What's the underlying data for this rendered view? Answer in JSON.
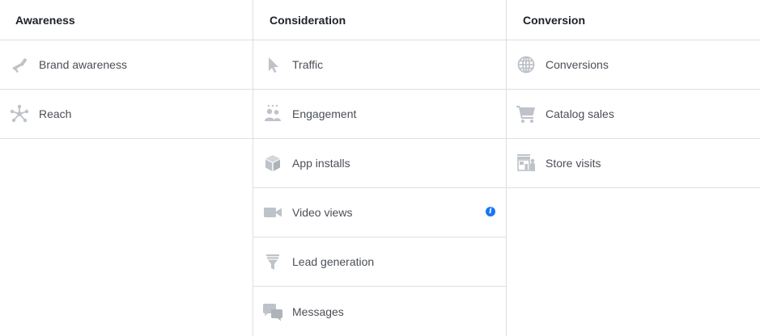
{
  "columns": [
    {
      "title": "Awareness",
      "items": [
        {
          "label": "Brand awareness",
          "icon": "megaphone-icon"
        },
        {
          "label": "Reach",
          "icon": "reach-network-icon"
        }
      ]
    },
    {
      "title": "Consideration",
      "items": [
        {
          "label": "Traffic",
          "icon": "cursor-icon"
        },
        {
          "label": "Engagement",
          "icon": "people-icon"
        },
        {
          "label": "App installs",
          "icon": "box-icon"
        },
        {
          "label": "Video views",
          "icon": "video-camera-icon",
          "has_info": true
        },
        {
          "label": "Lead generation",
          "icon": "funnel-icon"
        },
        {
          "label": "Messages",
          "icon": "chat-bubbles-icon"
        }
      ]
    },
    {
      "title": "Conversion",
      "items": [
        {
          "label": "Conversions",
          "icon": "globe-icon"
        },
        {
          "label": "Catalog sales",
          "icon": "shopping-cart-icon"
        },
        {
          "label": "Store visits",
          "icon": "storefront-icon"
        }
      ]
    }
  ],
  "info_glyph": "i",
  "colors": {
    "icon": "#bec3c9",
    "text": "#4b4f56",
    "header_text": "#1d2129",
    "divider": "#dddfe2",
    "info": "#1877f2"
  }
}
